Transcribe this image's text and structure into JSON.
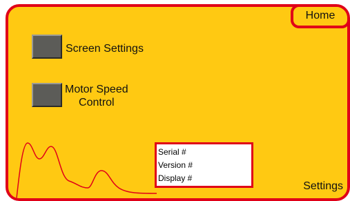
{
  "nav": {
    "home_label": "Home"
  },
  "buttons": [
    {
      "label_lines": [
        "Screen Settings"
      ]
    },
    {
      "label_lines": [
        "Motor Speed",
        "Control"
      ]
    }
  ],
  "info_box": {
    "lines": [
      "Serial #",
      "Version #",
      "Display #"
    ]
  },
  "footer": {
    "screen_name": "Settings"
  },
  "colors": {
    "panel_background": "#ffc912",
    "border_accent": "#e00018",
    "button_face": "#5c5c58"
  }
}
